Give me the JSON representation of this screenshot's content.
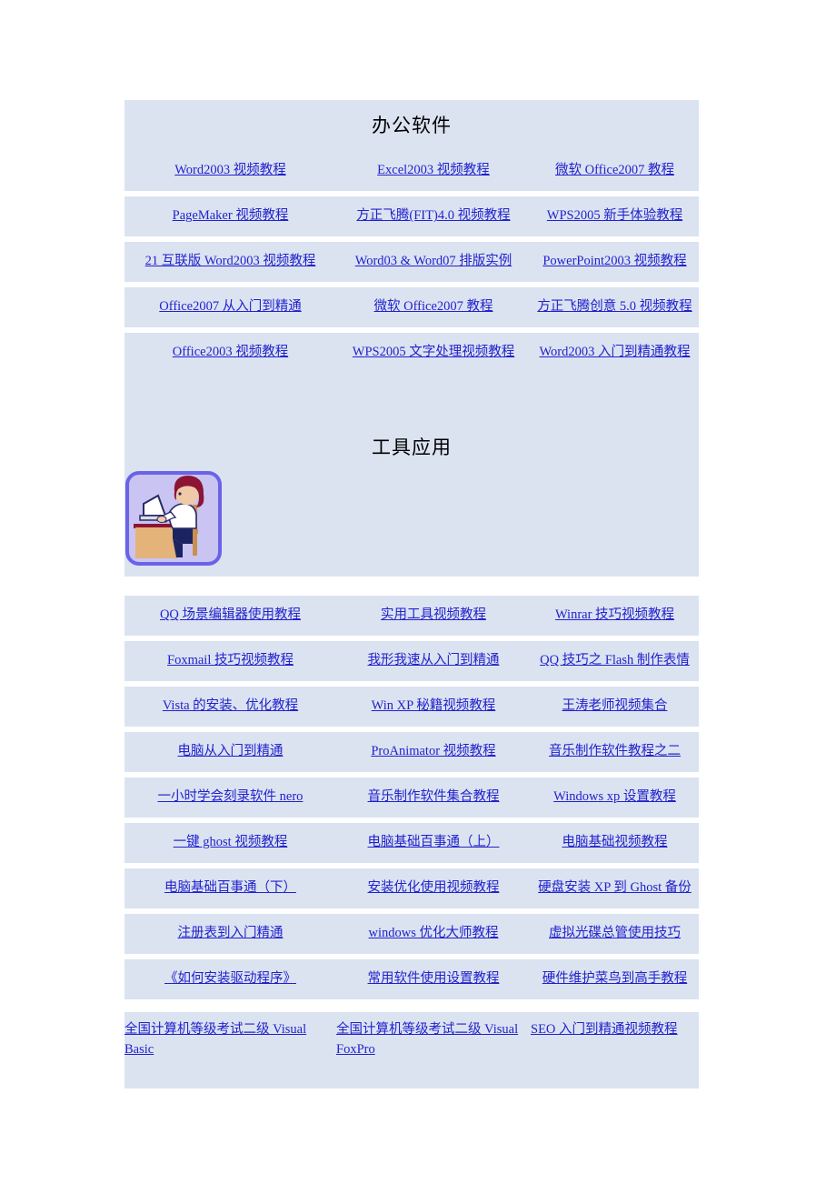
{
  "sections": [
    {
      "id": "office-software",
      "heading": "办公软件",
      "rows": [
        [
          "Word2003 视频教程",
          "Excel2003 视频教程 ",
          "微软 Office2007 教程"
        ],
        [
          "PageMaker 视频教程 ",
          "方正飞腾(FIT)4.0 视频教程 ",
          "WPS2005 新手体验教程 "
        ],
        [
          "21 互联版 Word2003 视频教程 ",
          "Word03 & Word07 排版实例 ",
          "PowerPoint2003 视频教程"
        ],
        [
          "Office2007 从入门到精通",
          "微软 Office2007 教程",
          "方正飞腾创意 5.0 视频教程"
        ],
        [
          "Office2003 视频教程",
          "WPS2005 文字处理视频教程",
          "Word2003 入门到精通教程"
        ]
      ]
    },
    {
      "id": "tool-applications",
      "heading": "工具应用",
      "banner_image": "person-at-computer-clipart",
      "rows": [
        [
          "QQ 场景编辑器使用教程 ",
          "实用工具视频教程 ",
          "Winrar 技巧视频教程 "
        ],
        [
          "Foxmail 技巧视频教程 ",
          "我形我速从入门到精通 ",
          "QQ 技巧之 Flash 制作表情 "
        ],
        [
          "Vista 的安装、优化教程",
          "Win XP 秘籍视频教程",
          "王涛老师视频集合 "
        ],
        [
          "电脑从入门到精通",
          "ProAnimator 视频教程 ",
          "音乐制作软件教程之二 "
        ],
        [
          "一小时学会刻录软件 nero",
          "音乐制作软件集合教程 ",
          "Windows xp 设置教程"
        ],
        [
          "一键 ghost 视频教程 ",
          "电脑基础百事通（上）",
          "电脑基础视频教程"
        ],
        [
          "电脑基础百事通（下） ",
          "安装优化使用视频教程",
          "硬盘安装 XP 到 Ghost 备份"
        ],
        [
          "注册表到入门精通",
          "windows 优化大师教程",
          "虚拟光碟总管使用技巧"
        ],
        [
          "《如何安装驱动程序》",
          "常用软件使用设置教程",
          "硬件维护菜鸟到高手教程"
        ],
        [
          "全国计算机等级考试二级 Visual Basic",
          "全国计算机等级考试二级 Visual FoxPro",
          "SEO 入门到精通视频教程"
        ]
      ]
    }
  ],
  "colors": {
    "cell_background": "#dbe3f1",
    "link": "#2222cc",
    "heading": "#000000",
    "page_background": "#ffffff"
  }
}
